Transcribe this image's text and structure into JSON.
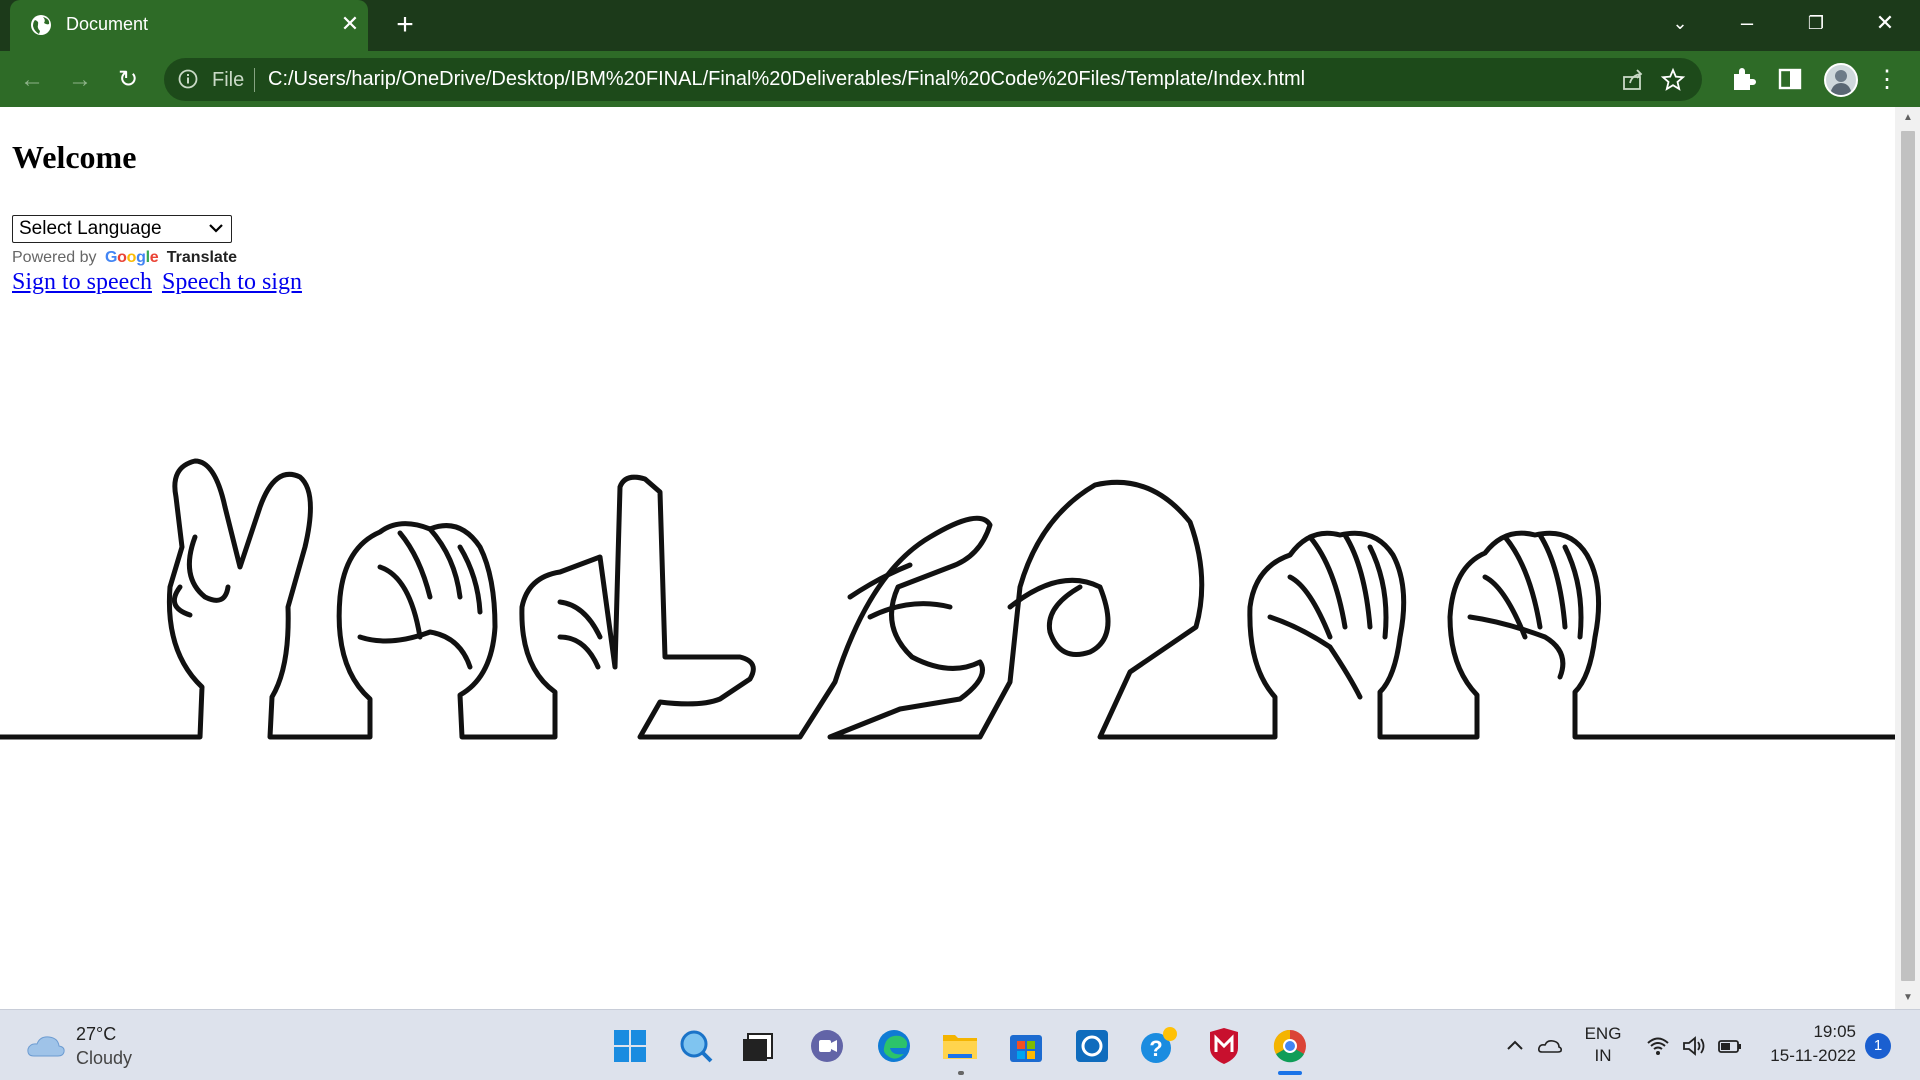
{
  "browser": {
    "tab_title": "Document",
    "address_prefix": "File",
    "url": "C:/Users/harip/OneDrive/Desktop/IBM%20FINAL/Final%20Deliverables/Final%20Code%20Files/Template/Index.html",
    "theme_color": "#2e6b27"
  },
  "page": {
    "heading": "Welcome",
    "language_select": "Select Language",
    "powered_by": "Powered by",
    "google": "Google",
    "translate": "Translate",
    "links": [
      {
        "label": "Sign to speech"
      },
      {
        "label": "Speech to sign"
      }
    ],
    "link_color": "#0000ee"
  },
  "taskbar": {
    "weather_temp": "27°C",
    "weather_condition": "Cloudy",
    "language_line1": "ENG",
    "language_line2": "IN",
    "time": "19:05",
    "date": "15-11-2022",
    "notification_count": "1"
  }
}
